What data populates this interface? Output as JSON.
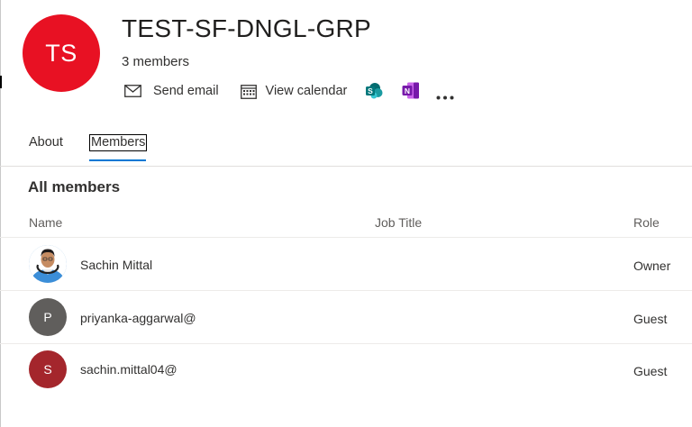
{
  "group": {
    "initials": "TS",
    "avatar_color": "#e81123",
    "title": "TEST-SF-DNGL-GRP",
    "member_count": "3 members"
  },
  "actions": {
    "send_email": "Send email",
    "view_calendar": "View calendar",
    "sharepoint_icon": "sharepoint-icon",
    "onenote_icon": "onenote-icon",
    "more_icon": "more-icon"
  },
  "tabs": {
    "about": "About",
    "members": "Members",
    "active": "members"
  },
  "members": {
    "section_title": "All members",
    "columns": {
      "name": "Name",
      "job_title": "Job Title",
      "role": "Role"
    },
    "rows": [
      {
        "name": "Sachin Mittal",
        "job_title": "",
        "role": "Owner",
        "initial": "",
        "avatar_color": "#5b9bd5",
        "avatar_type": "photo"
      },
      {
        "name": "priyanka-aggarwal@",
        "job_title": "",
        "role": "Guest",
        "initial": "P",
        "avatar_color": "#605e5c",
        "avatar_type": "initial"
      },
      {
        "name": "sachin.mittal04@",
        "job_title": "",
        "role": "Guest",
        "initial": "S",
        "avatar_color": "#a4262c",
        "avatar_type": "initial"
      }
    ]
  },
  "colors": {
    "accent": "#0078d4"
  }
}
